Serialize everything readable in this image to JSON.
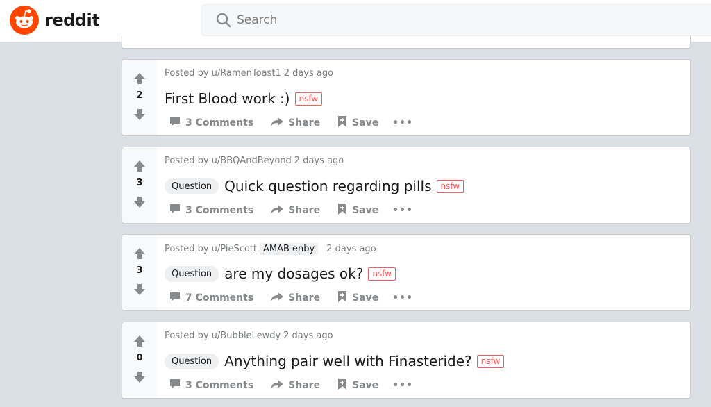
{
  "brand": {
    "name": "reddit",
    "color": "#ff4500"
  },
  "search": {
    "placeholder": "Search"
  },
  "actions": {
    "share": "Share",
    "save": "Save"
  },
  "posts": [
    {
      "score": "2",
      "author": "Posted by u/RamenToast1",
      "user_flair": "",
      "time": "2 days ago",
      "flair": "",
      "title": "First Blood work :)",
      "nsfw": "nsfw",
      "comments": "3 Comments"
    },
    {
      "score": "3",
      "author": "Posted by u/BBQAndBeyond",
      "user_flair": "",
      "time": "2 days ago",
      "flair": "Question",
      "title": "Quick question regarding pills",
      "nsfw": "nsfw",
      "comments": "3 Comments"
    },
    {
      "score": "3",
      "author": "Posted by u/PieScott",
      "user_flair": "AMAB enby",
      "time": "2 days ago",
      "flair": "Question",
      "title": "are my dosages ok?",
      "nsfw": "nsfw",
      "comments": "7 Comments"
    },
    {
      "score": "0",
      "author": "Posted by u/BubbleLewdy",
      "user_flair": "",
      "time": "2 days ago",
      "flair": "Question",
      "title": "Anything pair well with Finasteride?",
      "nsfw": "nsfw",
      "comments": "3 Comments"
    }
  ]
}
